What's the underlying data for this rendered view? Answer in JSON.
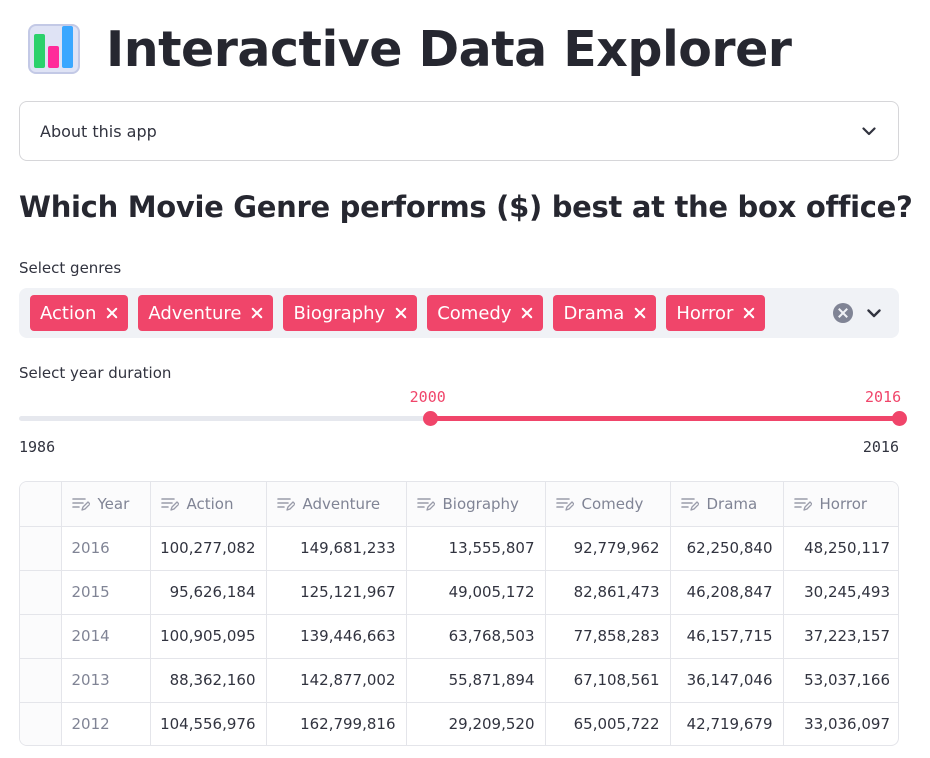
{
  "app": {
    "title": "Interactive Data Explorer",
    "title_icon": "bar-chart-icon"
  },
  "expander": {
    "label": "About this app",
    "expanded": false
  },
  "subheader": "Which Movie Genre performs ($) best at the box office?",
  "genres": {
    "label": "Select genres",
    "selected": [
      "Action",
      "Adventure",
      "Biography",
      "Comedy",
      "Drama",
      "Horror"
    ]
  },
  "years": {
    "label": "Select year duration",
    "min": 1986,
    "max": 2016,
    "value": [
      2000,
      2016
    ],
    "min_label": "1986",
    "max_label": "2016",
    "low_label": "2000",
    "high_label": "2016"
  },
  "table": {
    "columns": [
      "Year",
      "Action",
      "Adventure",
      "Biography",
      "Comedy",
      "Drama",
      "Horror"
    ],
    "rows": [
      [
        "2016",
        "100,277,082",
        "149,681,233",
        "13,555,807",
        "92,779,962",
        "62,250,840",
        "48,250,117"
      ],
      [
        "2015",
        "95,626,184",
        "125,121,967",
        "49,005,172",
        "82,861,473",
        "46,208,847",
        "30,245,493"
      ],
      [
        "2014",
        "100,905,095",
        "139,446,663",
        "63,768,503",
        "77,858,283",
        "46,157,715",
        "37,223,157"
      ],
      [
        "2013",
        "88,362,160",
        "142,877,002",
        "55,871,894",
        "67,108,561",
        "36,147,046",
        "53,037,166"
      ],
      [
        "2012",
        "104,556,976",
        "162,799,816",
        "29,209,520",
        "65,005,722",
        "42,719,679",
        "33,036,097"
      ]
    ]
  },
  "colors": {
    "accent": "#f0456a",
    "text": "#31333f",
    "muted": "#808495",
    "input_bg": "#f0f2f6"
  }
}
